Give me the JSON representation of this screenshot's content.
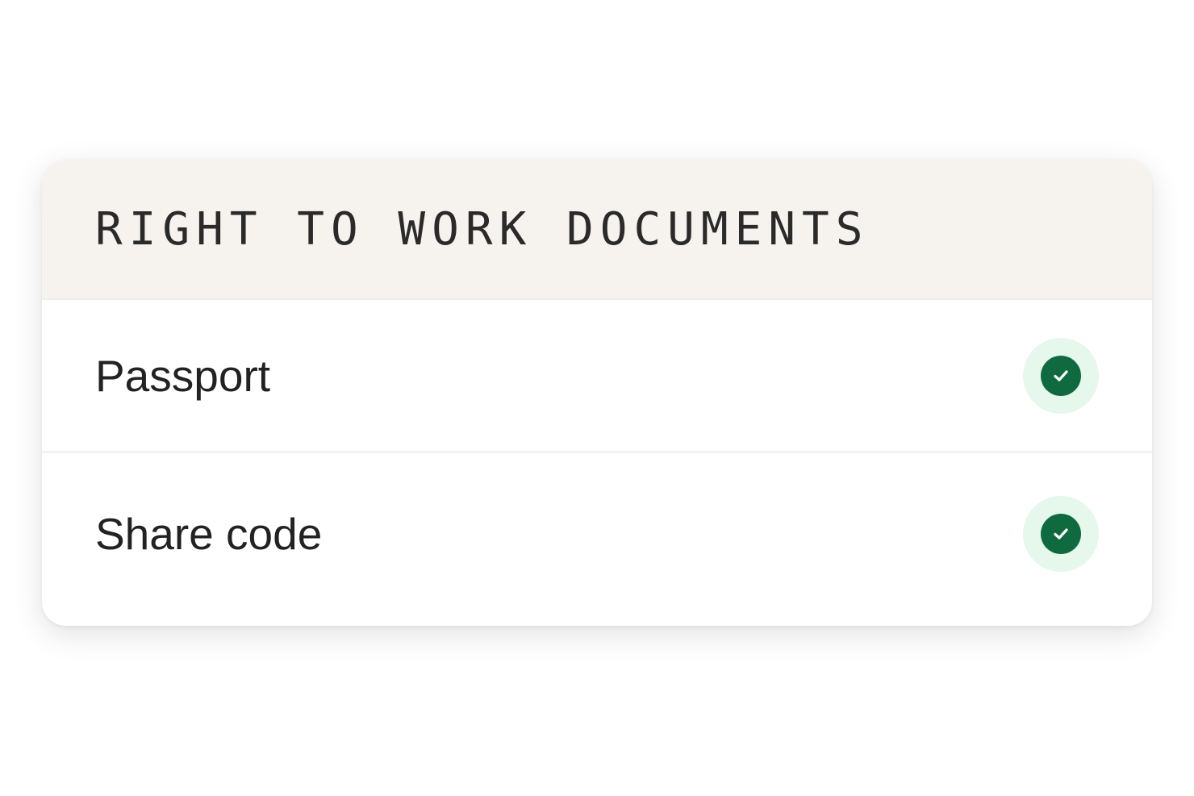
{
  "card": {
    "title": "RIGHT TO WORK DOCUMENTS",
    "items": [
      {
        "label": "Passport",
        "status": "check-icon"
      },
      {
        "label": "Share code",
        "status": "check-icon"
      }
    ]
  },
  "colors": {
    "status_ring": "#e6f7ec",
    "status_fill": "#0f6b3f",
    "header_bg": "#f6f3ef"
  }
}
